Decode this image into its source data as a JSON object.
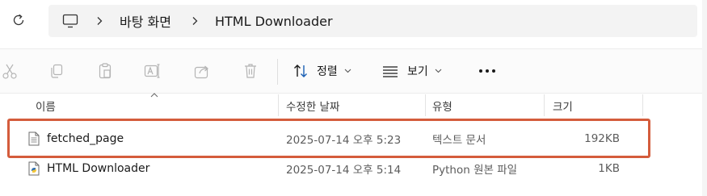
{
  "address_bar": {
    "crumbs": [
      "바탕 화면",
      "HTML Downloader"
    ]
  },
  "command_bar": {
    "tools": [
      {
        "name": "cut-icon"
      },
      {
        "name": "copy-icon"
      },
      {
        "name": "paste-icon"
      },
      {
        "name": "rename-icon"
      },
      {
        "name": "share-icon"
      },
      {
        "name": "delete-icon"
      }
    ],
    "sort_label": "정렬",
    "view_label": "보기"
  },
  "columns": {
    "name": "이름",
    "date": "수정한 날짜",
    "type": "유형",
    "size": "크기"
  },
  "files": [
    {
      "name": "fetched_page",
      "date": "2025-07-14 오후 5:23",
      "type": "텍스트 문서",
      "size": "192KB",
      "icon": "text-file-icon"
    },
    {
      "name": "HTML Downloader",
      "date": "2025-07-14 오후 5:14",
      "type": "Python 원본 파일",
      "size": "1KB",
      "icon": "python-file-icon"
    }
  ],
  "colors": {
    "highlight": "#d45c3c",
    "address_bg": "#f3f3f3"
  }
}
